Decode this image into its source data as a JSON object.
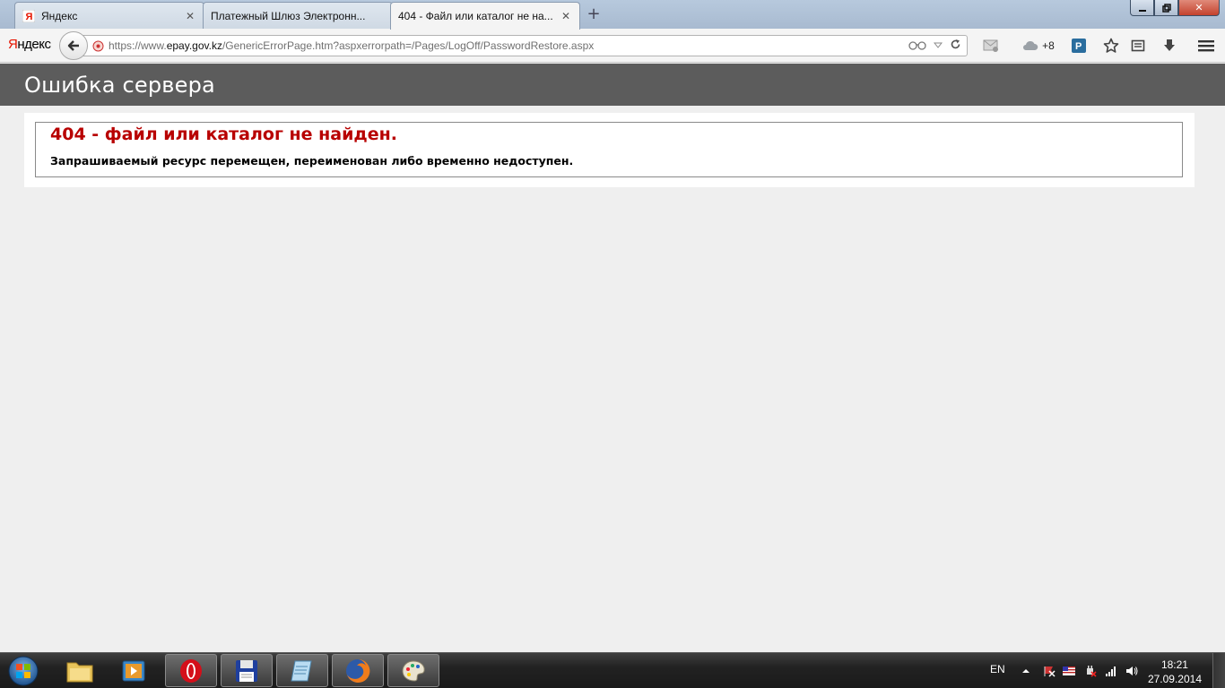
{
  "browser": {
    "tabs": [
      {
        "title": "Яндекс",
        "active": false
      },
      {
        "title": "Платежный Шлюз Электронн...",
        "active": false
      },
      {
        "title": "404 - Файл или каталог не на...",
        "active": true
      }
    ],
    "yandex_logo": "Яндекс",
    "url_prefix": "https://www.",
    "url_domain": "epay.gov.kz",
    "url_rest": "/GenericErrorPage.htm?aspxerrorpath=/Pages/LogOff/PasswordRestore.aspx",
    "cloud_count": "+8"
  },
  "page": {
    "header": "Ошибка сервера",
    "error_title": "404 - файл или каталог не найден.",
    "error_message": "Запрашиваемый ресурс перемещен, переименован либо временно недоступен."
  },
  "taskbar": {
    "lang": "EN",
    "time": "18:21",
    "date": "27.09.2014",
    "apps": [
      "explorer",
      "media",
      "opera",
      "save",
      "notepad",
      "firefox",
      "paint"
    ]
  },
  "colors": {
    "error_red": "#b80000",
    "header_bg": "#5c5c5c",
    "page_bg": "#efefef"
  }
}
